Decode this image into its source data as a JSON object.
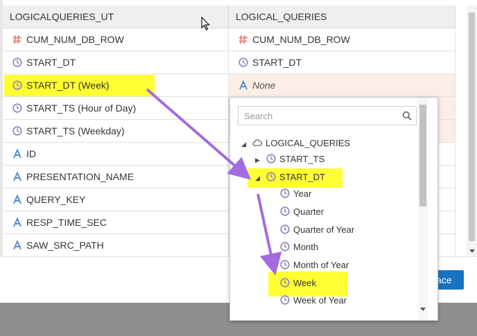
{
  "table": {
    "headers": {
      "left": "LOGICALQUERIES_UT",
      "right": "LOGICAL_QUERIES"
    },
    "rows": [
      {
        "left": "CUM_NUM_DB_ROW",
        "left_icon": "measure-icon",
        "right": "CUM_NUM_DB_ROW",
        "right_icon": "measure-icon"
      },
      {
        "left": "START_DT",
        "left_icon": "clock-icon",
        "right": "START_DT",
        "right_icon": "clock-icon"
      },
      {
        "left": "START_DT (Week)",
        "left_icon": "clock-icon",
        "right": "None",
        "right_icon": "text-attribute-icon"
      },
      {
        "left": "START_TS (Hour of Day)",
        "left_icon": "clock-icon",
        "right": "",
        "right_icon": ""
      },
      {
        "left": "START_TS (Weekday)",
        "left_icon": "clock-icon",
        "right": "",
        "right_icon": ""
      },
      {
        "left": "ID",
        "left_icon": "text-attribute-icon",
        "right": "",
        "right_icon": ""
      },
      {
        "left": "PRESENTATION_NAME",
        "left_icon": "text-attribute-icon",
        "right": "",
        "right_icon": ""
      },
      {
        "left": "QUERY_KEY",
        "left_icon": "text-attribute-icon",
        "right": "",
        "right_icon": ""
      },
      {
        "left": "RESP_TIME_SEC",
        "left_icon": "text-attribute-icon",
        "right": "",
        "right_icon": ""
      },
      {
        "left": "SAW_SRC_PATH",
        "left_icon": "text-attribute-icon",
        "right": "",
        "right_icon": ""
      }
    ]
  },
  "picker": {
    "search_placeholder": "Search",
    "search_icon": "search-icon",
    "tree": [
      {
        "label": "LOGICAL_QUERIES",
        "icon": "cloud-icon",
        "expander": "expanded"
      },
      {
        "label": "START_TS",
        "icon": "clock-icon",
        "expander": "collapsed"
      },
      {
        "label": "START_DT",
        "icon": "clock-icon",
        "expander": "expanded",
        "highlighted": true
      },
      {
        "label": "Year",
        "icon": "clock-icon"
      },
      {
        "label": "Quarter",
        "icon": "clock-icon"
      },
      {
        "label": "Quarter of Year",
        "icon": "clock-icon"
      },
      {
        "label": "Month",
        "icon": "clock-icon"
      },
      {
        "label": "Month of Year",
        "icon": "clock-icon"
      },
      {
        "label": "Week",
        "icon": "clock-icon",
        "highlighted": true
      },
      {
        "label": "Week of Year",
        "icon": "clock-icon"
      }
    ]
  },
  "footer": {
    "replace_label": "lace"
  },
  "colors": {
    "highlight": "#ffff33",
    "arrow": "#a46be0",
    "clock": "#8c7fb8",
    "measure": "#e08a7a",
    "text_attr": "#5b8fc9",
    "button": "#1a73c0",
    "peach": "#fbeee6"
  }
}
